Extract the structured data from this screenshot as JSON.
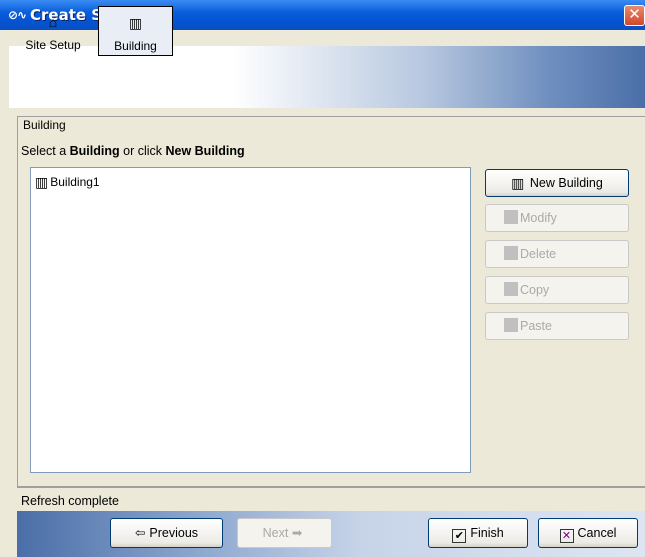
{
  "window": {
    "title": "Create Site"
  },
  "toolbar": {
    "items": [
      {
        "label": "Site Setup",
        "icon": "site-setup-icon"
      },
      {
        "label": "Building",
        "icon": "building-icon",
        "active": true
      }
    ]
  },
  "panel": {
    "legend": "Building",
    "prompt_pre": "Select a ",
    "prompt_b1": "Building",
    "prompt_mid": " or click ",
    "prompt_b2": "New Building"
  },
  "list": {
    "items": [
      "Building1"
    ]
  },
  "side_buttons": {
    "new_building": "New Building",
    "modify": "Modify",
    "delete": "Delete",
    "copy": "Copy",
    "paste": "Paste"
  },
  "status": "Refresh complete",
  "nav": {
    "previous": "Previous",
    "next": "Next",
    "finish": "Finish",
    "cancel": "Cancel"
  },
  "colors": {
    "title_bar": "#0454d3",
    "close_button": "#d2482c",
    "dialog_bg": "#ece9d8"
  }
}
